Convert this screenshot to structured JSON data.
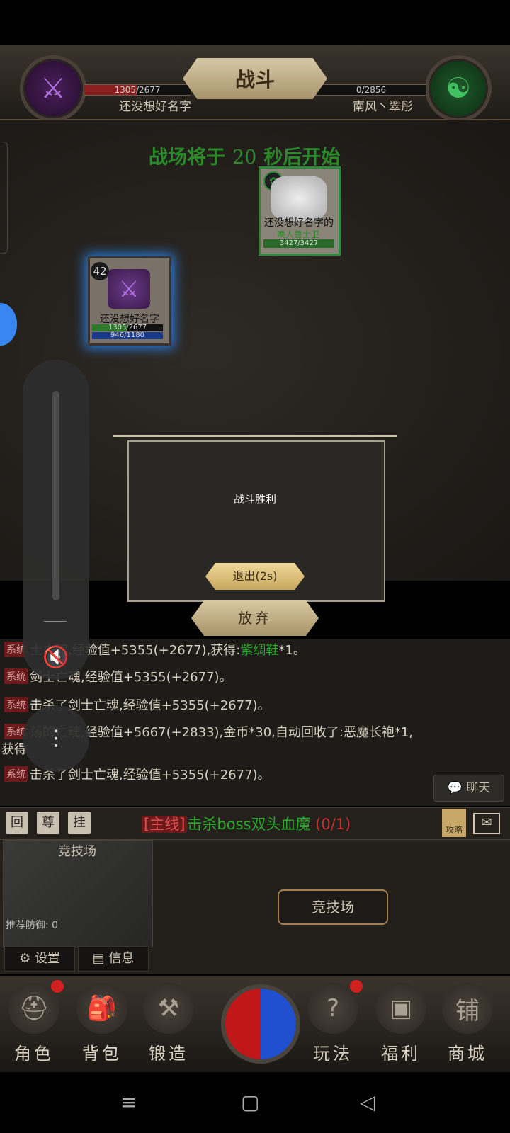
{
  "header": {
    "title": "战斗",
    "left_player": {
      "hp_text": "1305/2677",
      "name": "还没想好名字",
      "icon": "sword-icon"
    },
    "right_player": {
      "hp_text": "0/2856",
      "name": "南风丶翠彤",
      "icon": "yin-yang-icon"
    }
  },
  "battlefield": {
    "countdown_prefix": "战场将于",
    "countdown_value": "20",
    "countdown_suffix": "秒后开始",
    "enemy": {
      "name": "还没想好名字的",
      "title": "唤人兽士卫",
      "hp": "3427/3427"
    },
    "player": {
      "level": "42",
      "name": "还没想好名字",
      "hp": "1305/2677",
      "mp": "946/1180"
    }
  },
  "modal": {
    "message": "战斗胜利",
    "exit_label": "退出(2s)"
  },
  "abandon_label": "放弃",
  "log": {
    "tag": "系统",
    "lines": [
      {
        "text": "士亡魂,经验值+5355(+2677),获得:",
        "item": "紫绸鞋",
        "suffix": "*1。"
      },
      {
        "text": "剑士亡魂,经验值+5355(+2677)。"
      },
      {
        "text": "击杀了剑士亡魂,经验值+5355(+2677)。"
      },
      {
        "text": "荡的亡魂,经验值+5667(+2833),金币*30,自动回收了:恶魔长袍*1,"
      },
      {
        "text": "获得"
      },
      {
        "text": "击杀了剑士亡魂,经验值+5355(+2677)。"
      }
    ],
    "chat_label": "聊天"
  },
  "questbar": {
    "btn_return": "回",
    "btn_honor": "尊",
    "btn_idle": "挂",
    "quest_tag": "[主线]",
    "quest_text": "击杀boss双头血魔",
    "quest_progress": "(0/1)",
    "guide_label": "攻略"
  },
  "panel": {
    "map_title": "竞技场",
    "recommended_def": "推荐防御: 0",
    "settings_label": "设置",
    "info_label": "信息",
    "arena_button": "竞技场"
  },
  "nav": {
    "items": [
      {
        "label": "角色",
        "icon": "helmet-icon",
        "badge": true
      },
      {
        "label": "背包",
        "icon": "bag-icon",
        "badge": false
      },
      {
        "label": "锻造",
        "icon": "anvil-icon",
        "badge": false
      },
      {
        "label": "玩法",
        "icon": "help-book-icon",
        "badge": true
      },
      {
        "label": "福利",
        "icon": "chest-icon",
        "badge": false
      },
      {
        "label": "商城",
        "icon": "shop-icon",
        "badge": false,
        "shop_sign": "铺"
      }
    ]
  },
  "colors": {
    "accent_green": "#2aa82a",
    "accent_red": "#c03030",
    "gold": "#c8a860"
  }
}
